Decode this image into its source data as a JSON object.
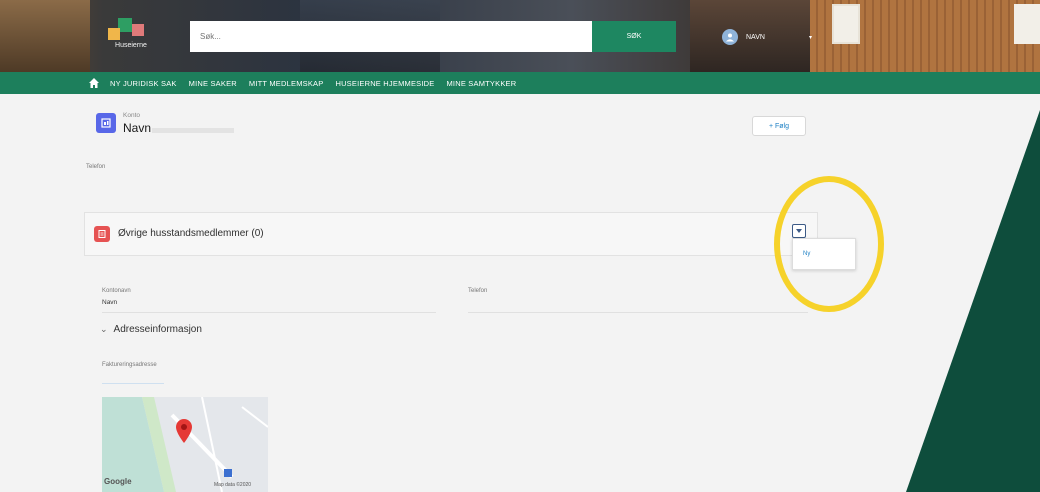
{
  "header": {
    "logo_text": "Huseierne",
    "search_placeholder": "Søk...",
    "search_button": "SØK",
    "user_name": "NAVN",
    "user_chevron": "▾"
  },
  "nav": {
    "items": [
      "NY JURIDISK SAK",
      "MINE SAKER",
      "MITT MEDLEMSKAP",
      "HUSEIERNE HJEMMESIDE",
      "MINE SAMTYKKER"
    ]
  },
  "record": {
    "type": "Konto",
    "name": "Navn",
    "follow_label": "+ Følg",
    "phone_label": "Telefon"
  },
  "related": {
    "title": "Øvrige husstandsmedlemmer (0)",
    "menu_item": "Ny"
  },
  "details": {
    "account_name_label": "Kontonavn",
    "account_name_value": "Navn",
    "phone_label": "Telefon",
    "section_title": "Adresseinformasjon",
    "billing_label": "Faktureringsadresse"
  },
  "map": {
    "logo": "Google",
    "attribution": "Map data ©2020"
  },
  "colors": {
    "nav_green": "#1d7f5c",
    "search_button": "#1e8761",
    "highlight": "#f6d22a",
    "panel_green": "#0e4d3c"
  }
}
